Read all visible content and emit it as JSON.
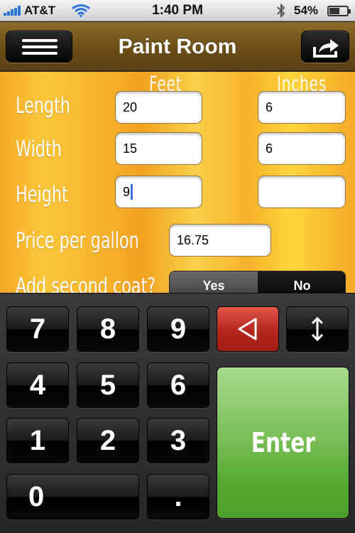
{
  "status_bar": {
    "carrier": "AT&T",
    "time": "1:40 PM",
    "battery_percent": "54%",
    "battery_level": 0.54,
    "icons": [
      "signal-icon",
      "wifi-icon",
      "bluetooth-icon",
      "battery-icon"
    ]
  },
  "navbar": {
    "title": "Paint Room",
    "left_button_icon": "menu-icon",
    "right_button_icon": "share-icon"
  },
  "form": {
    "column_headers": {
      "feet": "Feet",
      "inches": "Inches"
    },
    "rows": [
      {
        "label": "Length",
        "feet": "20",
        "inches": "6"
      },
      {
        "label": "Width",
        "feet": "15",
        "inches": "6"
      },
      {
        "label": "Height",
        "feet": "9",
        "inches": ""
      }
    ],
    "price_label": "Price per gallon",
    "price_value": "16.75",
    "second_coat_label": "Add second coat?",
    "second_coat_options": {
      "yes": "Yes",
      "no": "No"
    }
  },
  "keypad": {
    "digits": [
      "7",
      "8",
      "9",
      "4",
      "5",
      "6",
      "1",
      "2",
      "3",
      "0",
      "."
    ],
    "delete_icon": "backspace-triangle-icon",
    "toggle_icon": "up-down-arrow-icon",
    "enter_label": "Enter",
    "colors": {
      "delete": "#c0392b",
      "enter": "#6ab344"
    }
  }
}
